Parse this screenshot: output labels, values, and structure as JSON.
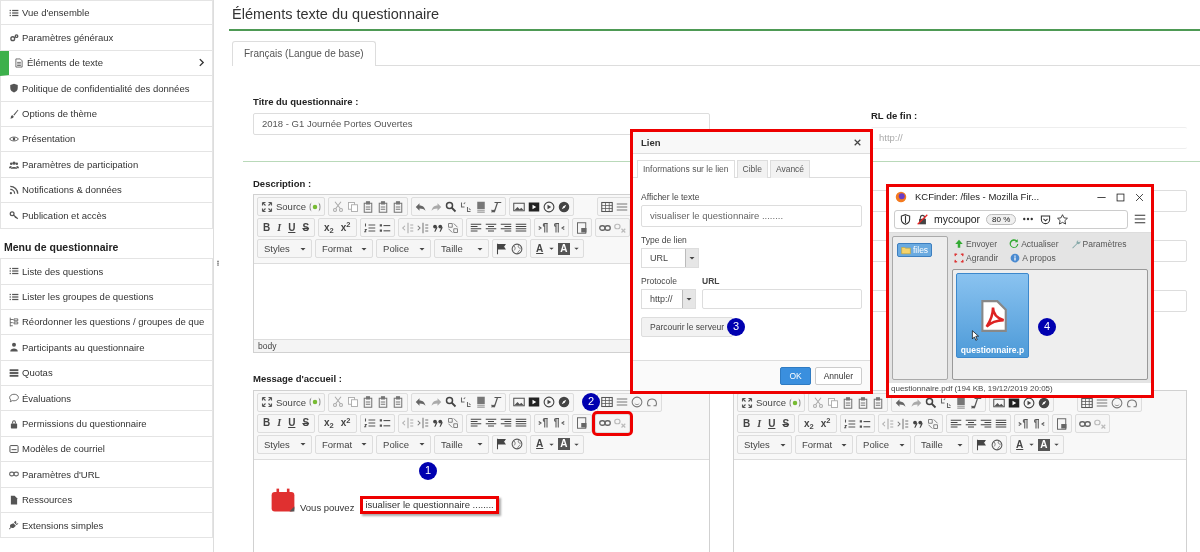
{
  "sidebar": {
    "items": [
      {
        "label": "Vue d'ensemble",
        "selected": false
      },
      {
        "label": "Paramètres généraux",
        "selected": false
      },
      {
        "label": "Éléments de texte",
        "selected": true
      },
      {
        "label": "Politique de confidentialité des données",
        "selected": false
      },
      {
        "label": "Options de thème",
        "selected": false
      },
      {
        "label": "Présentation",
        "selected": false
      },
      {
        "label": "Paramètres de participation",
        "selected": false
      },
      {
        "label": "Notifications & données",
        "selected": false
      },
      {
        "label": "Publication et accès",
        "selected": false
      }
    ],
    "section_heading": "Menu de questionnaire",
    "section_items": [
      {
        "label": "Liste des questions",
        "selected": false
      },
      {
        "label": "Lister les groupes de questions",
        "selected": false
      },
      {
        "label": "Réordonner les questions / groupes de que",
        "selected": false
      },
      {
        "label": "Participants au questionnaire",
        "selected": false
      },
      {
        "label": "Quotas",
        "selected": false
      },
      {
        "label": "Évaluations",
        "selected": false
      },
      {
        "label": "Permissions du questionnaire",
        "selected": false
      },
      {
        "label": "Modèles de courriel",
        "selected": false
      },
      {
        "label": "Paramètres d'URL",
        "selected": false
      },
      {
        "label": "Ressources",
        "selected": false
      },
      {
        "label": "Extensions simples",
        "selected": false
      }
    ]
  },
  "page_title": "Éléments texte du questionnaire",
  "language_tabs": [
    {
      "label": "Français (Langue de base)",
      "selected": true
    }
  ],
  "survey_title": {
    "label": "Titre du questionnaire :",
    "value": "2018 - G1 Journée Portes Ouvertes"
  },
  "end_url": {
    "label": "RL de fin :",
    "placeholder": "http://"
  },
  "description": {
    "label": "Description :",
    "editor": {
      "source": "Source",
      "letters": [
        "B",
        "I",
        "U",
        "S"
      ],
      "scripts": [
        "x$_{2}$",
        "x$^{2}$"
      ],
      "dropdowns": [
        "Styles",
        "Format",
        "Police",
        "Taille"
      ],
      "colors": [
        "A",
        "A"
      ]
    },
    "element_path": "body"
  },
  "welcome_message": {
    "label": "Message d'accueil :",
    "editor": {
      "source": "Source",
      "letters": [
        "B",
        "I",
        "U",
        "S"
      ],
      "scripts": [
        "x$_{2}$",
        "x$^{2}$"
      ],
      "dropdowns": [
        "Styles",
        "Format",
        "Police",
        "Taille"
      ],
      "colors": [
        "A",
        "A"
      ],
      "link_buttons_highlighted": true
    },
    "content_text": "Vous pouvez",
    "link_text": "isualiser le questionnaire ........"
  },
  "end_message": {
    "editor": {
      "source": "Source",
      "letters": [
        "B",
        "I",
        "U",
        "S"
      ],
      "scripts": [
        "x$_{2}$",
        "x$^{2}$"
      ],
      "dropdowns": [
        "Styles",
        "Format",
        "Police",
        "Taille"
      ],
      "colors": [
        "A",
        "A"
      ]
    }
  },
  "link_dialog": {
    "title": "Lien",
    "tabs": [
      {
        "label": "Informations sur le lien",
        "selected": true
      },
      {
        "label": "Cible",
        "selected": false
      },
      {
        "label": "Avancé",
        "selected": false
      }
    ],
    "display_text": {
      "label": "Afficher le texte",
      "value": "visualiser le questionnaire ........"
    },
    "link_type": {
      "label": "Type de lien",
      "value": "URL"
    },
    "protocol": {
      "label": "Protocole",
      "value": "http://"
    },
    "url": {
      "label": "URL"
    },
    "browse_button": "Parcourir le serveur",
    "buttons": [
      "OK",
      "Annuler"
    ]
  },
  "file_browser": {
    "window_title": "KCFinder: /files - Mozilla Fir...",
    "address": "mycoupor",
    "zoom": "80 %",
    "folders": [
      {
        "label": "files",
        "selected": true
      }
    ],
    "actions": [
      "Envoyer",
      "Actualiser",
      "Paramètres",
      "Agrandir",
      "A propos"
    ],
    "files": [
      {
        "name": "questionnaire.p",
        "selected": true
      }
    ],
    "status_name": "questionnaire.pdf",
    "status_info": "(194 KB, 19/12/2019 20:05)"
  },
  "annotations": [
    {
      "number": "1"
    },
    {
      "number": "2"
    },
    {
      "number": "3"
    },
    {
      "number": "4"
    }
  ]
}
